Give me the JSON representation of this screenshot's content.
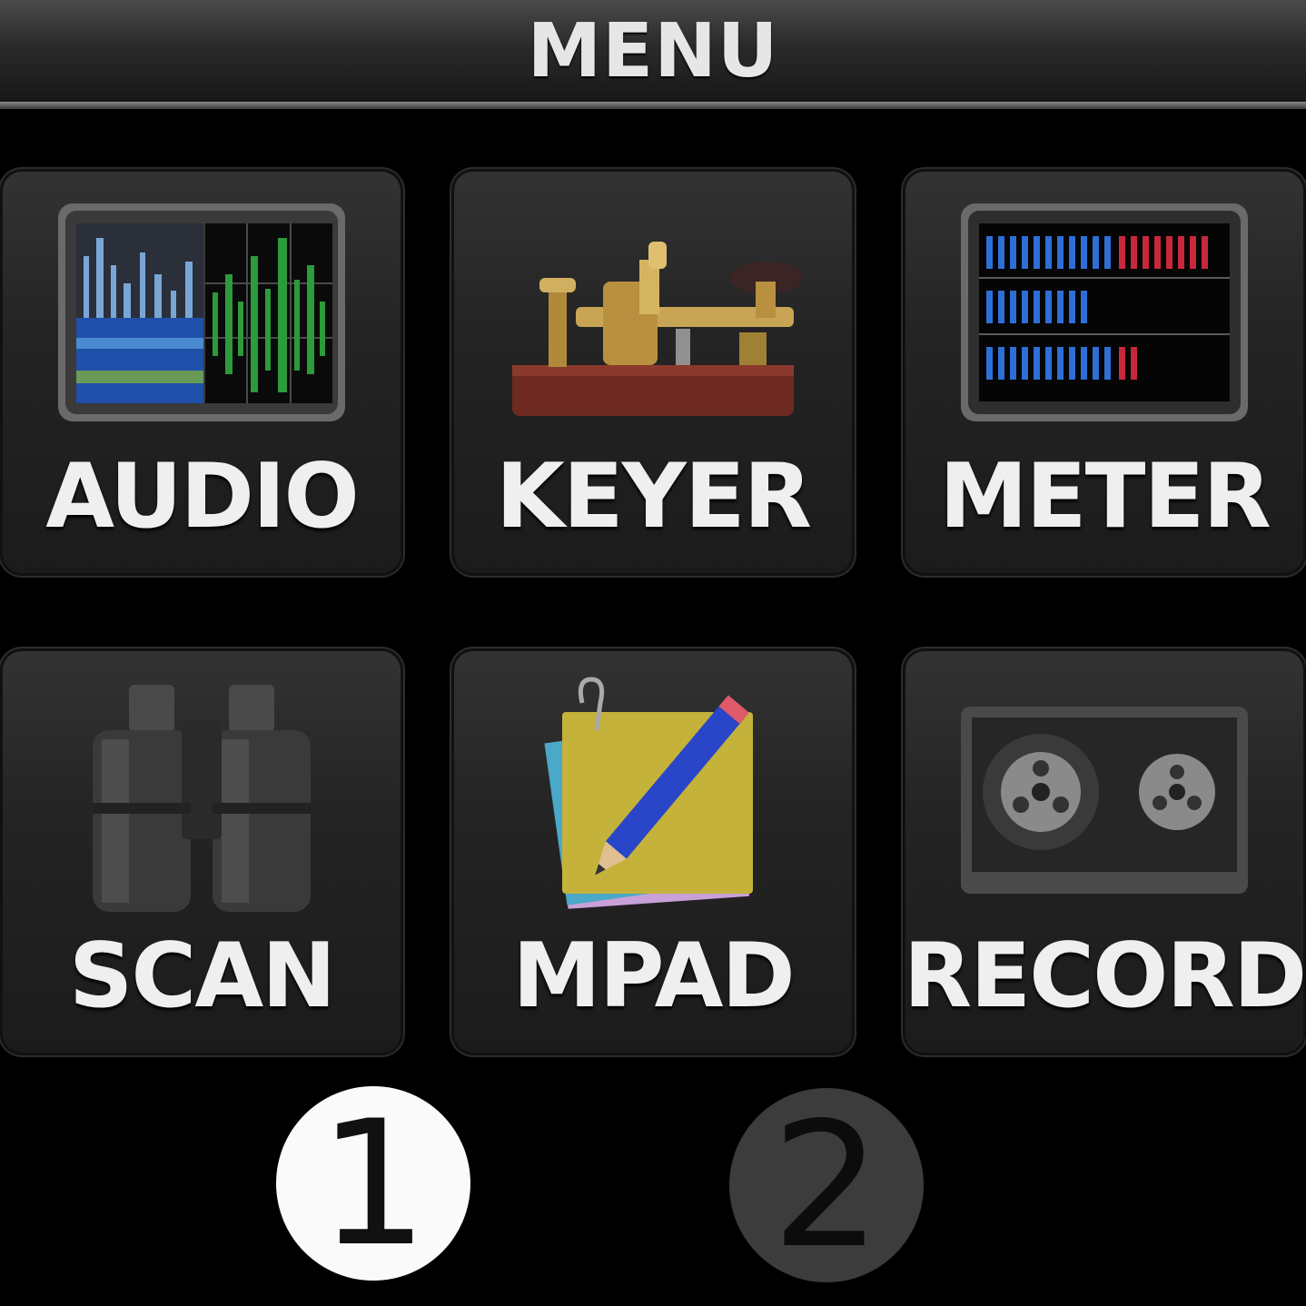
{
  "header": {
    "title": "MENU"
  },
  "tiles": [
    {
      "label": "AUDIO",
      "icon": "spectrum-scope-icon"
    },
    {
      "label": "KEYER",
      "icon": "telegraph-key-icon"
    },
    {
      "label": "METER",
      "icon": "level-meter-icon"
    },
    {
      "label": "SCAN",
      "icon": "binoculars-icon"
    },
    {
      "label": "MPAD",
      "icon": "memo-pad-pencil-icon"
    },
    {
      "label": "RECORD",
      "icon": "tape-reels-icon"
    }
  ],
  "pagination": {
    "page1": "1",
    "page2": "2",
    "active": "1"
  },
  "colors": {
    "active_dot": "#fafafa",
    "inactive_dot": "#3c3c3c",
    "meter_blue": "#2d6fd6",
    "meter_red": "#c8283c"
  }
}
